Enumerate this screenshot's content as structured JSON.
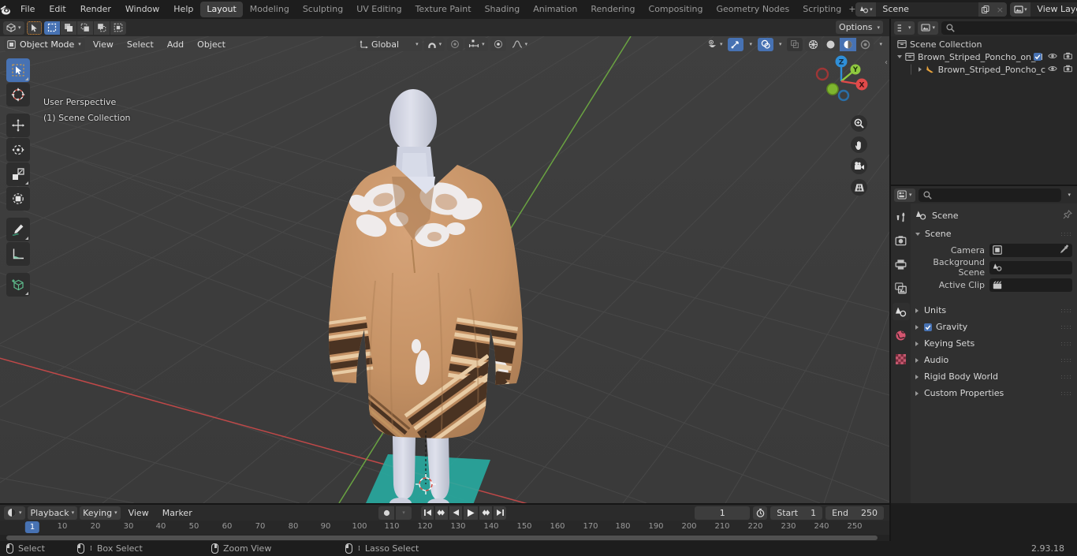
{
  "app": {
    "name": "Blender",
    "version": "2.93.18",
    "logo_icon": "blender-logo-icon"
  },
  "topbar": {
    "menus": [
      "File",
      "Edit",
      "Render",
      "Window",
      "Help"
    ],
    "workspaces": [
      {
        "label": "Layout",
        "active": true
      },
      {
        "label": "Modeling",
        "active": false
      },
      {
        "label": "Sculpting",
        "active": false
      },
      {
        "label": "UV Editing",
        "active": false
      },
      {
        "label": "Texture Paint",
        "active": false
      },
      {
        "label": "Shading",
        "active": false
      },
      {
        "label": "Animation",
        "active": false
      },
      {
        "label": "Rendering",
        "active": false
      },
      {
        "label": "Compositing",
        "active": false
      },
      {
        "label": "Geometry Nodes",
        "active": false
      },
      {
        "label": "Scripting",
        "active": false
      }
    ],
    "add_workspace_label": "+",
    "scene": {
      "icon": "scene-icon",
      "name": "Scene",
      "new_label": "copy-icon",
      "unlink_label": "×"
    },
    "view_layer": {
      "icon": "view-layer-icon",
      "name": "View Layer",
      "new_label": "copy-icon",
      "unlink_label": "×"
    }
  },
  "viewport_header": {
    "editor_type_icon": "editor-type-3dview-icon",
    "cursor_tool_icon": "select-tool-icon",
    "select_modes": [
      "set-icon",
      "extend-icon",
      "subtract-icon",
      "invert-icon",
      "intersect-icon"
    ],
    "mode": "Object Mode",
    "mode_icon": "object-mode-icon",
    "menus": [
      "View",
      "Select",
      "Add",
      "Object"
    ],
    "transform_orientation": "Global",
    "transform_orientation_icon": "orientation-icon",
    "snap_icon": "magnet-icon",
    "proportional_icon": "proportional-edit-icon",
    "proportional_falloff_icon": "falloff-curve-icon",
    "options_label": "Options",
    "visibility_icon": "show-hide-icon",
    "gizmo_icon": "gizmo-icon",
    "overlay_icon": "overlays-icon",
    "xray_icon": "xray-icon",
    "shading_modes": [
      "wireframe-icon",
      "solid-icon",
      "material-preview-icon",
      "rendered-icon"
    ],
    "shading_active_index": 2
  },
  "viewport": {
    "overlay_line1": "User Perspective",
    "overlay_line2": "(1) Scene Collection",
    "background_color": "#3d3d3d",
    "grid_color": "#4a4a4a",
    "axis_x_color": "#cf4a4a",
    "axis_y_color": "#79c14b",
    "tools": [
      {
        "name": "tweak-tool",
        "icon": "cursor-arrow-icon",
        "active": true
      },
      {
        "name": "cursor-tool",
        "icon": "3d-cursor-icon",
        "active": false
      },
      {
        "name": "move-tool",
        "icon": "move-arrows-icon",
        "active": false
      },
      {
        "name": "rotate-tool",
        "icon": "rotate-icon",
        "active": false
      },
      {
        "name": "scale-tool",
        "icon": "scale-icon",
        "active": false
      },
      {
        "name": "transform-tool",
        "icon": "transform-icon",
        "active": false
      },
      {
        "name": "annotate-tool",
        "icon": "pencil-icon",
        "active": false
      },
      {
        "name": "measure-tool",
        "icon": "ruler-icon",
        "active": false
      },
      {
        "name": "add-cube-tool",
        "icon": "add-cube-icon",
        "active": false
      }
    ],
    "gizmo": {
      "axes": [
        "Z",
        "Y",
        "X"
      ],
      "z_color": "#2f8fd8",
      "y_color": "#8fc93f",
      "x_color": "#e04a4a"
    },
    "nav_buttons": [
      {
        "name": "zoom-view-button",
        "icon": "magnify-icon"
      },
      {
        "name": "pan-view-button",
        "icon": "hand-icon"
      },
      {
        "name": "camera-view-button",
        "icon": "camera-icon"
      },
      {
        "name": "toggle-ortho-button",
        "icon": "grid-perspective-icon"
      }
    ],
    "model": {
      "name": "Brown Striped Poncho on Mannequin",
      "poncho_base_color": "#c69367",
      "poncho_stripe_dark": "#4a3322",
      "poncho_stripe_light": "#e8cba4",
      "mannequin_color": "#d2d4e0",
      "ground_patch_color": "#3ec2b8"
    }
  },
  "outliner": {
    "display_mode_icon": "outliner-display-icon",
    "filter_type_icon": "view-layer-icon",
    "search_placeholder": "",
    "filter_icon": "funnel-icon",
    "new_collection_icon": "new-collection-icon",
    "rows": [
      {
        "label": "Scene Collection",
        "icon": "collection-icon",
        "indent": 0,
        "expandable": false,
        "expanded": false,
        "has_checkbox": false,
        "has_eye": false,
        "has_camera": false
      },
      {
        "label": "Brown_Striped_Poncho_on_M",
        "icon": "collection-icon",
        "indent": 1,
        "expandable": true,
        "expanded": true,
        "has_checkbox": true,
        "has_eye": true,
        "has_camera": true
      },
      {
        "label": "Brown_Striped_Poncho_c",
        "icon": "armature-icon",
        "indent": 2,
        "expandable": true,
        "expanded": false,
        "has_checkbox": false,
        "has_eye": true,
        "has_camera": true
      }
    ]
  },
  "properties": {
    "editor_icon": "properties-editor-icon",
    "search_placeholder": "",
    "tabs": [
      {
        "name": "tool-tab",
        "icon": "tool-icon",
        "active": false
      },
      {
        "name": "render-tab",
        "icon": "render-camera-icon",
        "active": false
      },
      {
        "name": "output-tab",
        "icon": "printer-icon",
        "active": false
      },
      {
        "name": "view-layer-tab",
        "icon": "images-icon",
        "active": false
      },
      {
        "name": "scene-tab",
        "icon": "scene-cone-icon",
        "active": true
      },
      {
        "name": "world-tab",
        "icon": "world-globe-icon",
        "active": false
      },
      {
        "name": "texture-tab",
        "icon": "checker-texture-icon",
        "active": false
      }
    ],
    "breadcrumb": {
      "icon": "scene-cone-icon",
      "label": "Scene",
      "pin_icon": "pin-icon"
    },
    "panels": [
      {
        "label": "Scene",
        "expanded": true,
        "fields": [
          {
            "label": "Camera",
            "value": "",
            "icon": "camera-data-icon",
            "extra_icon": "eyedropper-icon"
          },
          {
            "label": "Background Scene",
            "value": "",
            "icon": "scene-cone-icon",
            "extra_icon": ""
          },
          {
            "label": "Active Clip",
            "value": "",
            "icon": "movie-clip-icon",
            "extra_icon": ""
          }
        ]
      },
      {
        "label": "Units",
        "expanded": false,
        "checkbox": null
      },
      {
        "label": "Gravity",
        "expanded": false,
        "checkbox": true
      },
      {
        "label": "Keying Sets",
        "expanded": false,
        "checkbox": null
      },
      {
        "label": "Audio",
        "expanded": false,
        "checkbox": null
      },
      {
        "label": "Rigid Body World",
        "expanded": false,
        "checkbox": null
      },
      {
        "label": "Custom Properties",
        "expanded": false,
        "checkbox": null
      }
    ]
  },
  "timeline": {
    "editor_icon": "timeline-editor-icon",
    "menus": [
      {
        "label": "Playback",
        "dropdown": true
      },
      {
        "label": "Keying",
        "dropdown": true
      },
      {
        "label": "View",
        "dropdown": false
      },
      {
        "label": "Marker",
        "dropdown": false
      }
    ],
    "record_icon": "record-icon",
    "transport": [
      {
        "name": "jump-to-start-button",
        "icon": "jump-start-icon"
      },
      {
        "name": "jump-to-prev-keyframe-button",
        "icon": "prev-keyframe-icon"
      },
      {
        "name": "play-reverse-button",
        "icon": "play-reverse-icon"
      },
      {
        "name": "play-button",
        "icon": "play-icon"
      },
      {
        "name": "jump-to-next-keyframe-button",
        "icon": "next-keyframe-icon"
      },
      {
        "name": "jump-to-end-button",
        "icon": "jump-end-icon"
      }
    ],
    "current_frame": "1",
    "use_preview_range_icon": "stopwatch-icon",
    "start_label": "Start",
    "start_value": "1",
    "end_label": "End",
    "end_value": "250",
    "playhead_frame": 1,
    "ticks": [
      10,
      20,
      30,
      40,
      50,
      60,
      70,
      80,
      90,
      100,
      110,
      120,
      130,
      140,
      150,
      160,
      170,
      180,
      190,
      200,
      210,
      220,
      230,
      240,
      250
    ]
  },
  "statusbar": {
    "items": [
      {
        "label": "Select",
        "icon": "mouse-left-icon"
      },
      {
        "label": "Box Select",
        "icon": "mouse-left-drag-icon"
      },
      {
        "label": "Zoom View",
        "icon": "mouse-middle-icon"
      },
      {
        "label": "Lasso Select",
        "icon": "mouse-right-drag-icon"
      }
    ],
    "version": "2.93.18"
  }
}
